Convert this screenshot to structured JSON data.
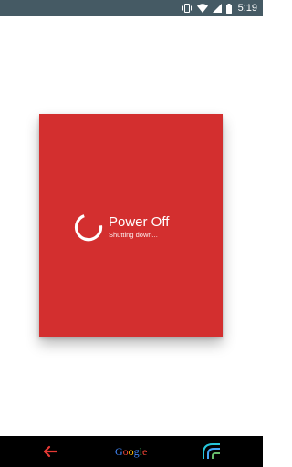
{
  "status_bar": {
    "time": "5:19",
    "icons": [
      "vibrate-icon",
      "wifi-icon",
      "signal-icon",
      "battery-icon"
    ]
  },
  "power_dialog": {
    "title": "Power Off",
    "subtitle": "Shutting down...",
    "spinner_icon": "loading-spinner-icon"
  },
  "nav_bar": {
    "back_icon": "back-arrow-icon",
    "home_label": "Google",
    "home_letters": [
      "G",
      "o",
      "o",
      "g",
      "l",
      "e"
    ],
    "recents_icon": "recents-icon"
  },
  "colors": {
    "status_bar": "#455a64",
    "dialog": "#d32f2f",
    "nav_bar": "#000000",
    "back_arrow": "#e53935",
    "google_blue": "#4285f4",
    "google_red": "#ea4335",
    "google_yellow": "#fbbc05",
    "google_green": "#34a853"
  }
}
